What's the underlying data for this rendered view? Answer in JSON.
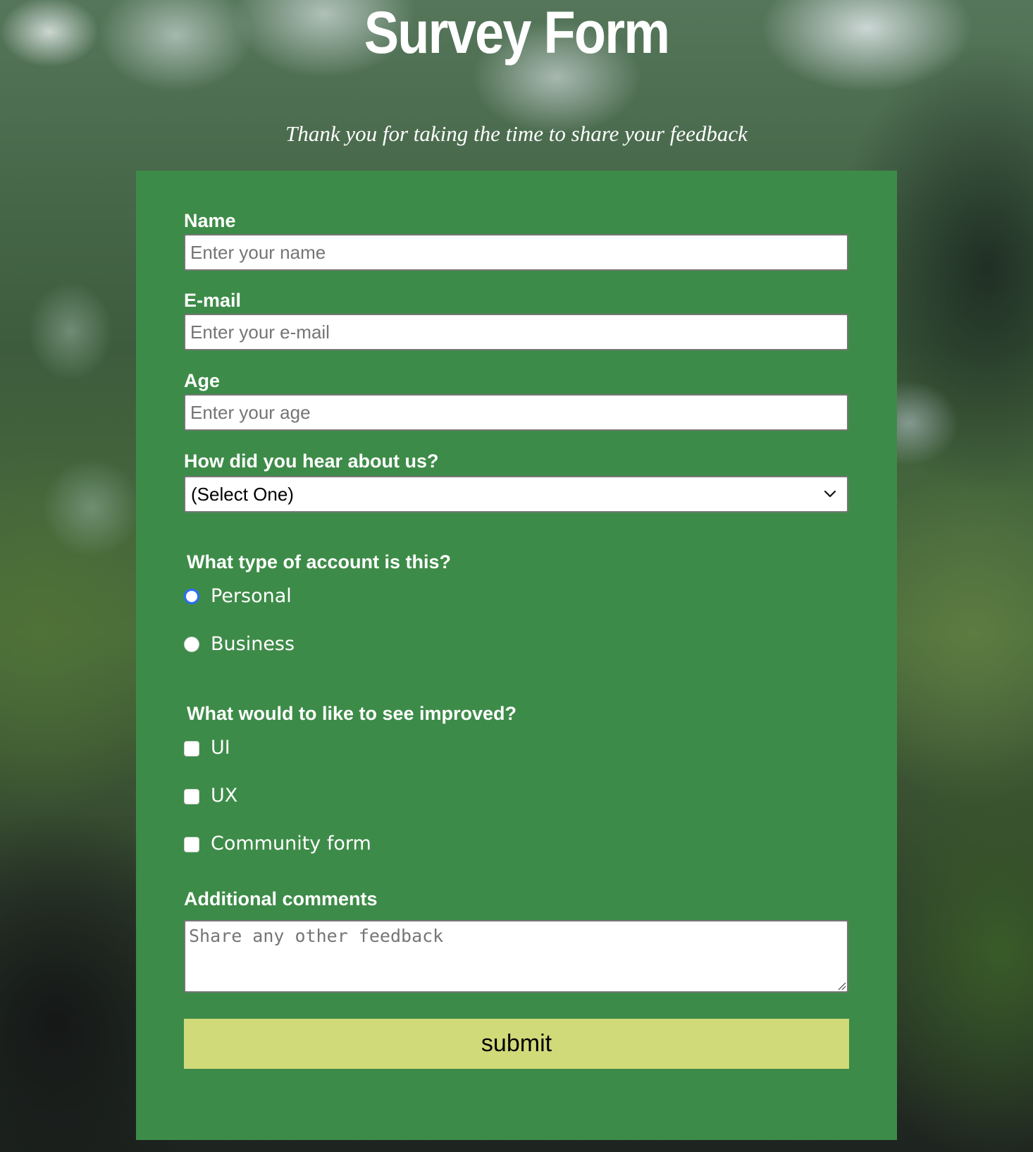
{
  "page": {
    "title": "Survey Form",
    "description": "Thank you for taking the time to share your feedback"
  },
  "form": {
    "name": {
      "label": "Name",
      "placeholder": "Enter your name",
      "value": ""
    },
    "email": {
      "label": "E-mail",
      "placeholder": "Enter your e-mail",
      "value": ""
    },
    "age": {
      "label": "Age",
      "placeholder": "Enter your age",
      "value": ""
    },
    "referral": {
      "label": "How did you hear about us?",
      "selected": "(Select One)",
      "icon": "chevron-down-icon"
    },
    "account_type": {
      "label": "What type of account is this?",
      "options": [
        {
          "label": "Personal",
          "checked": true
        },
        {
          "label": "Business",
          "checked": false
        }
      ]
    },
    "improvements": {
      "label": "What would to like to see improved?",
      "options": [
        {
          "label": "UI",
          "checked": false
        },
        {
          "label": "UX",
          "checked": false
        },
        {
          "label": "Community form",
          "checked": false
        }
      ]
    },
    "comments": {
      "label": "Additional comments",
      "placeholder": "Share any other feedback",
      "value": ""
    },
    "submit_label": "submit"
  },
  "colors": {
    "form_background": "#3d8b48",
    "submit_background": "#d1da79",
    "radio_checked": "#2b6cff",
    "text": "#ffffff"
  }
}
